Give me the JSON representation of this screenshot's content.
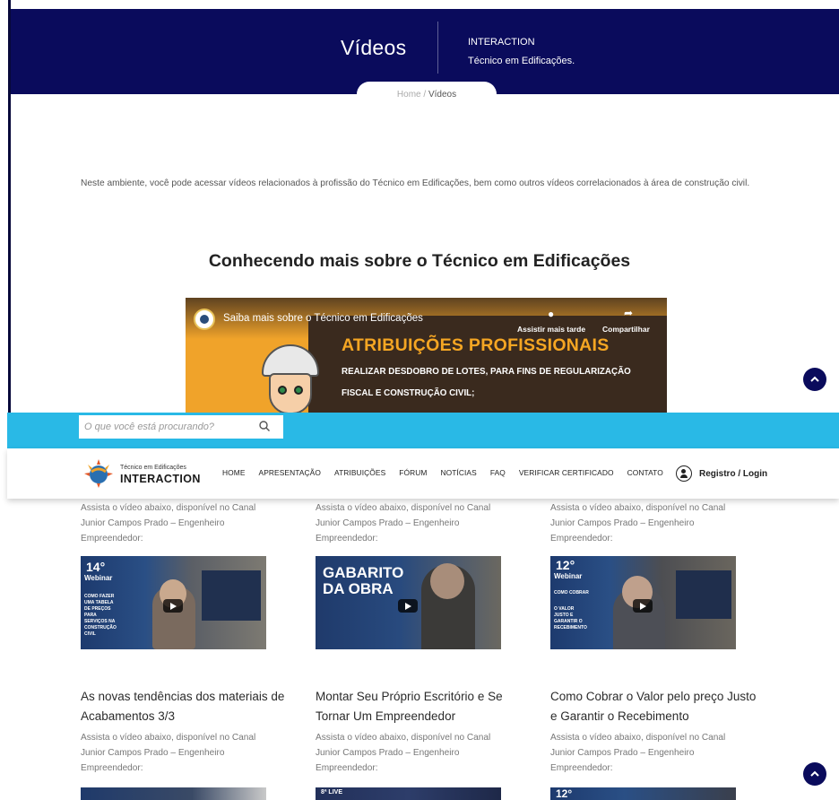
{
  "hero": {
    "title": "Vídeos",
    "brand": "INTERACTION",
    "subtitle": "Técnico em Edificações."
  },
  "breadcrumb": {
    "home": "Home",
    "separator": "/",
    "current": "Vídeos"
  },
  "intro": "Neste ambiente, você pode acessar vídeos relacionados à profissão do Técnico em Edificações, bem como outros vídeos correlacionados à área de construção civil.",
  "section_title": "Conhecendo mais sobre o Técnico em Edificações",
  "main_video": {
    "title": "Saiba mais sobre o Técnico em Edificações",
    "watch_later": "Assistir mais tarde",
    "share": "Compartilhar",
    "headline": "ATRIBUIÇÕES PROFISSIONAIS",
    "line1": "REALIZAR DESDOBRO DE LOTES, PARA FINS DE REGULARIZAÇÃO",
    "line2": "FISCAL E CONSTRUÇÃO CIVIL;",
    "background_color": "#f0a32a",
    "headline_color": "#f5a623"
  },
  "search": {
    "placeholder": "O que você está procurando?"
  },
  "logo": {
    "small": "Técnico em Edificações",
    "big": "INTERACTION"
  },
  "nav": {
    "items": [
      "HOME",
      "APRESENTAÇÃO",
      "ATRIBUIÇÕES",
      "FÓRUM",
      "NOTÍCIAS",
      "FAQ",
      "VERIFICAR CERTIFICADO",
      "CONTATO"
    ],
    "login": "Registro / Login"
  },
  "cards_row1": [
    {
      "desc": [
        "Assista o vídeo abaixo, disponível no Canal",
        "Junior Campos Prado – Engenheiro",
        "Empreendedor:"
      ],
      "thumb_text": [
        "14°",
        "Webinar",
        "COMO FAZER UMA TABELA DE PREÇOS PARA SERVIÇOS NA CONSTRUÇÃO CIVIL"
      ]
    },
    {
      "desc": [
        "Assista o vídeo abaixo, disponível no Canal",
        "Junior Campos Prado – Engenheiro",
        "Empreendedor:"
      ],
      "thumb_text": [
        "GABARITO",
        "DA OBRA"
      ]
    },
    {
      "desc": [
        "Assista o vídeo abaixo, disponível no Canal",
        "Junior Campos Prado – Engenheiro",
        "Empreendedor:"
      ],
      "thumb_text": [
        "12°",
        "Webinar",
        "COMO COBRAR",
        "O VALOR JUSTO E GARANTIR O RECEBIMENTO"
      ]
    }
  ],
  "cards_row2": [
    {
      "title": [
        "As novas tendências dos materiais de",
        "Acabamentos 3/3"
      ],
      "desc": [
        "Assista o vídeo abaixo, disponível no Canal",
        "Junior Campos Prado – Engenheiro",
        "Empreendedor:"
      ]
    },
    {
      "title": [
        "Montar Seu Próprio Escritório e Se",
        "Tornar Um Empreendedor"
      ],
      "desc": [
        "Assista o vídeo abaixo, disponível no Canal",
        "Junior Campos Prado – Engenheiro",
        "Empreendedor:"
      ],
      "thumb_text": [
        "8ª LIVE"
      ]
    },
    {
      "title": [
        "Como Cobrar o Valor pelo preço Justo",
        "e Garantir o Recebimento"
      ],
      "desc": [
        "Assista o vídeo abaixo, disponível no Canal",
        "Junior Campos Prado – Engenheiro",
        "Empreendedor:"
      ],
      "thumb_text": [
        "12°"
      ]
    }
  ],
  "colors": {
    "navy": "#0a0b5c",
    "cyan": "#29b9e6",
    "scroll_button": "#0a0b5c"
  },
  "icons": {
    "scroll_up": "chevron-up-icon",
    "search": "magnifier-icon",
    "user": "user-circle-icon"
  }
}
